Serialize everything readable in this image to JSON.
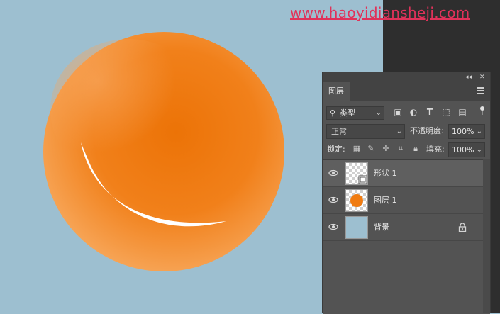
{
  "watermark": "www.haoyidiansheji.com",
  "colors": {
    "canvas": "#9dbfd0",
    "ball": "#f07c12",
    "highlight": "#ffffff",
    "panel": "#535353"
  },
  "panel": {
    "tab_label": "图层",
    "collapse_icon": "double-chevron-icon",
    "close_icon": "close-icon",
    "filter": {
      "label": "类型",
      "icons": [
        "image-filter-icon",
        "adjustment-filter-icon",
        "type-filter-icon",
        "shape-filter-icon",
        "smart-object-filter-icon"
      ]
    },
    "blend_mode": "正常",
    "opacity_label": "不透明度:",
    "opacity_value": "100%",
    "lock_label": "锁定:",
    "fill_label": "填充:",
    "fill_value": "100%",
    "layers": [
      {
        "name": "形状 1",
        "visible": true,
        "selected": true,
        "thumb": "shape"
      },
      {
        "name": "图层 1",
        "visible": true,
        "selected": false,
        "thumb": "orange-dot"
      },
      {
        "name": "背景",
        "visible": true,
        "selected": false,
        "thumb": "blue",
        "locked": true
      }
    ]
  }
}
